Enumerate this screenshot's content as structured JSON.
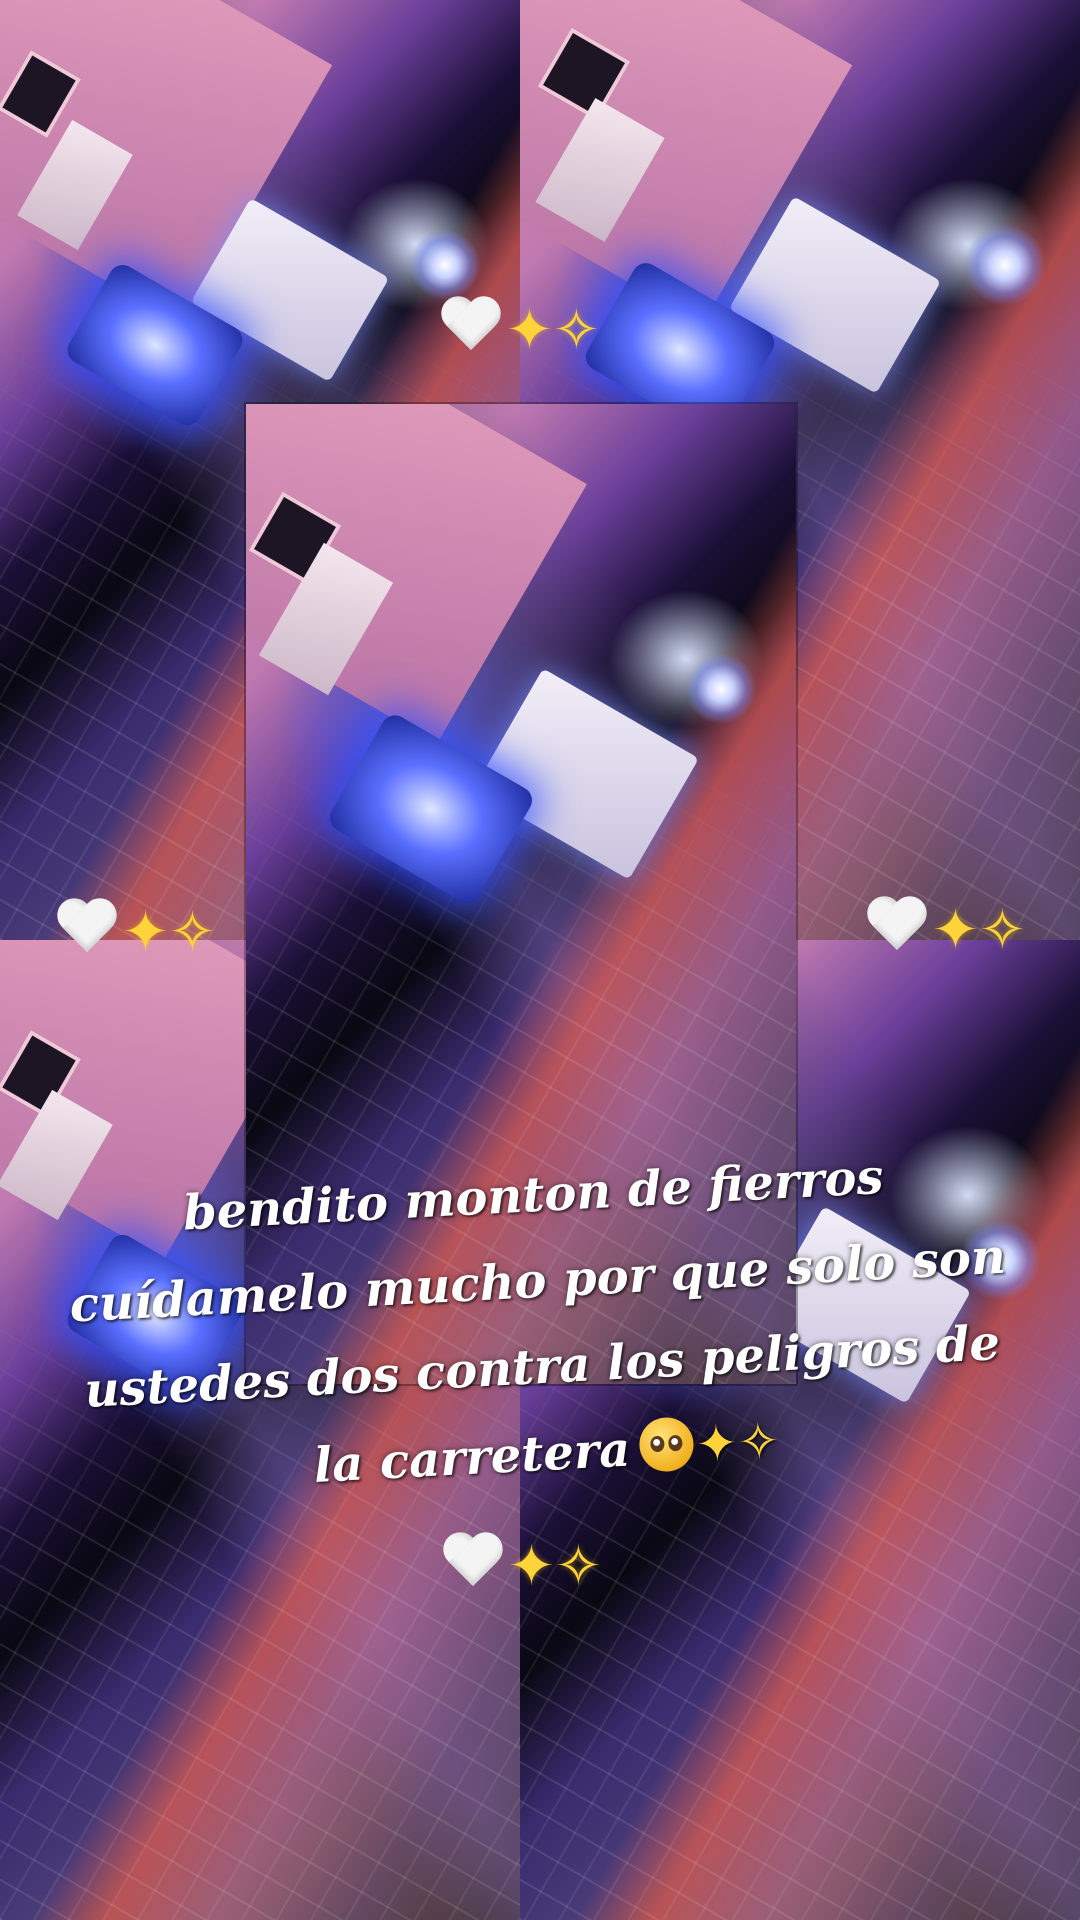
{
  "caption": {
    "line1": "bendito monton de fierros",
    "line2": "cuídamelo mucho por que solo son",
    "line3": "ustedes dos contra los peligros de",
    "line4": "la carretera"
  },
  "decorations": {
    "emoji_pair": "🤍✨",
    "heart_icon": "white-heart",
    "sparkles_glyph": "✦✧",
    "caption_end_icons": [
      "pleading-face",
      "sparkles"
    ]
  },
  "colors": {
    "text": "#ffffff",
    "glow": "#3b4cff",
    "sparkle": "#ffd43a"
  }
}
